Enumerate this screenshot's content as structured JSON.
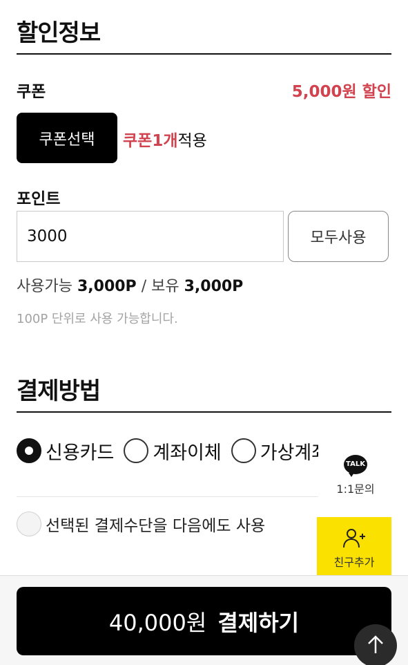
{
  "discount_section": {
    "title": "할인정보",
    "coupon": {
      "label": "쿠폰",
      "discount_text": "5,000원 할인",
      "select_button": "쿠폰선택",
      "applied_highlight": "쿠폰1개",
      "applied_suffix": "적용"
    },
    "point": {
      "label": "포인트",
      "input_value": "3000",
      "use_all_button": "모두사용",
      "available_prefix": "사용가능",
      "available_value": "3,000P",
      "separator": "/",
      "owned_prefix": "보유",
      "owned_value": "3,000P",
      "note": "100P 단위로 사용 가능합니다."
    }
  },
  "payment_section": {
    "title": "결제방법",
    "options": [
      {
        "label": "신용카드",
        "selected": true
      },
      {
        "label": "계좌이체",
        "selected": false
      },
      {
        "label": "가상계좌",
        "selected": false
      }
    ],
    "save_method_label": "선택된 결제수단을 다음에도 사용"
  },
  "floating": {
    "talk_icon_text": "TALK",
    "talk_label": "1:1문의",
    "friend_label": "친구추가",
    "friend_icon": "add-person-icon",
    "friend_bg_color": "#fae100"
  },
  "checkout": {
    "amount": "40,000원",
    "label": "결제하기"
  },
  "colors": {
    "accent": "#d1434f",
    "primary_button": "#000000"
  }
}
